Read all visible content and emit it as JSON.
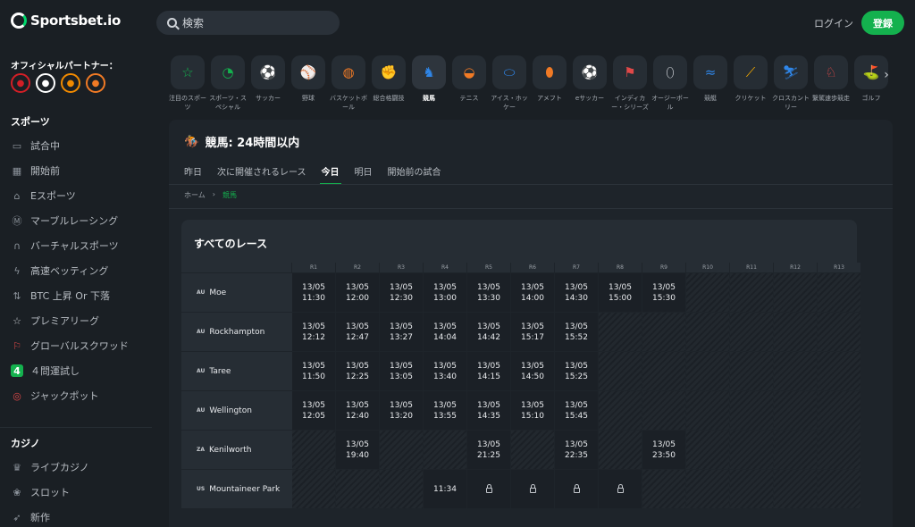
{
  "brand": {
    "name": "Sportsbet.io"
  },
  "search": {
    "placeholder": "検索"
  },
  "header": {
    "login": "ログイン",
    "register": "登録"
  },
  "sidebar": {
    "partner_title": "オフィシャルパートナー：",
    "partners": [
      {
        "icon": "flamengo-logo",
        "color": "#d31f26"
      },
      {
        "icon": "newcastle-logo",
        "color": "#ffffff"
      },
      {
        "icon": "hull-city-logo",
        "color": "#f18a00"
      },
      {
        "icon": "basketball-logo",
        "color": "#f07a25"
      }
    ],
    "sports_title": "スポーツ",
    "sports_items": [
      {
        "label": "試合中",
        "icon": "monitor-icon"
      },
      {
        "label": "開始前",
        "icon": "calendar-icon"
      },
      {
        "label": "Eスポーツ",
        "icon": "gamepad-icon"
      },
      {
        "label": "マーブルレーシング",
        "icon": "marble-icon"
      },
      {
        "label": "バーチャルスポーツ",
        "icon": "headset-icon"
      },
      {
        "label": "高速ベッティング",
        "icon": "bolt-icon"
      },
      {
        "label": "BTC 上昇 Or 下落",
        "icon": "updown-icon"
      },
      {
        "label": "プレミアリーグ",
        "icon": "star-icon"
      },
      {
        "label": "グローバルスクワッド",
        "icon": "squad-icon"
      },
      {
        "label": "４問運試し",
        "icon": "four-icon"
      },
      {
        "label": "ジャックポット",
        "icon": "target-icon"
      }
    ],
    "casino_title": "カジノ",
    "casino_items": [
      {
        "label": "ライブカジノ",
        "icon": "dealer-icon"
      },
      {
        "label": "スロット",
        "icon": "cherry-icon"
      },
      {
        "label": "新作",
        "icon": "rocket-icon"
      }
    ]
  },
  "sports_bar": [
    {
      "label": "注目のスポーツ",
      "icon": "star-icon",
      "color": "#14b14e"
    },
    {
      "label": "スポーツ・スペシャル",
      "icon": "special-icon",
      "color": "#14b14e"
    },
    {
      "label": "サッカー",
      "icon": "soccer-icon",
      "color": "#e04848"
    },
    {
      "label": "野球",
      "icon": "baseball-icon",
      "color": "#e04848"
    },
    {
      "label": "バスケットボール",
      "icon": "basketball-icon",
      "color": "#f07a25"
    },
    {
      "label": "総合格闘技",
      "icon": "mma-icon",
      "color": "#f2a900"
    },
    {
      "label": "競馬",
      "icon": "horse-racing-icon",
      "color": "#2f86e8"
    },
    {
      "label": "テニス",
      "icon": "tennis-icon",
      "color": "#f07a25"
    },
    {
      "label": "アイス・ホッケー",
      "icon": "ice-hockey-icon",
      "color": "#2f86e8"
    },
    {
      "label": "アメフト",
      "icon": "football-icon",
      "color": "#f07a25"
    },
    {
      "label": "eサッカー",
      "icon": "esoccer-icon",
      "color": "#e04848"
    },
    {
      "label": "インディカー・シリーズ",
      "icon": "flag-icon",
      "color": "#e04848"
    },
    {
      "label": "オージーボール",
      "icon": "aussie-ball-icon",
      "color": "#c4c8cd"
    },
    {
      "label": "競艇",
      "icon": "boat-icon",
      "color": "#2f86e8"
    },
    {
      "label": "クリケット",
      "icon": "cricket-icon",
      "color": "#f2a900"
    },
    {
      "label": "クロスカントリー",
      "icon": "ski-icon",
      "color": "#2f86e8"
    },
    {
      "label": "繋駕速歩競走",
      "icon": "harness-icon",
      "color": "#e04848"
    },
    {
      "label": "ゴルフ",
      "icon": "golf-icon",
      "color": "#f2a900"
    }
  ],
  "main": {
    "title": "競馬: 24時間以内",
    "tabs": [
      "昨日",
      "次に開催されるレース",
      "今日",
      "明日",
      "開始前の試合"
    ],
    "active_tab": 2,
    "breadcrumb": [
      "ホーム",
      "競馬"
    ],
    "card_title": "すべてのレース",
    "columns": [
      "R1",
      "R2",
      "R3",
      "R4",
      "R5",
      "R6",
      "R7",
      "R8",
      "R9",
      "R10",
      "R11",
      "R12",
      "R13"
    ],
    "rows": [
      {
        "cc": "AU",
        "name": "Moe",
        "cells": [
          {
            "d": "13/05",
            "t": "11:30"
          },
          {
            "d": "13/05",
            "t": "12:00"
          },
          {
            "d": "13/05",
            "t": "12:30"
          },
          {
            "d": "13/05",
            "t": "13:00"
          },
          {
            "d": "13/05",
            "t": "13:30"
          },
          {
            "d": "13/05",
            "t": "14:00"
          },
          {
            "d": "13/05",
            "t": "14:30"
          },
          {
            "d": "13/05",
            "t": "15:00"
          },
          {
            "d": "13/05",
            "t": "15:30"
          },
          null,
          null,
          null,
          null
        ]
      },
      {
        "cc": "AU",
        "name": "Rockhampton",
        "cells": [
          {
            "d": "13/05",
            "t": "12:12"
          },
          {
            "d": "13/05",
            "t": "12:47"
          },
          {
            "d": "13/05",
            "t": "13:27"
          },
          {
            "d": "13/05",
            "t": "14:04"
          },
          {
            "d": "13/05",
            "t": "14:42"
          },
          {
            "d": "13/05",
            "t": "15:17"
          },
          {
            "d": "13/05",
            "t": "15:52"
          },
          null,
          null,
          null,
          null,
          null,
          null
        ]
      },
      {
        "cc": "AU",
        "name": "Taree",
        "cells": [
          {
            "d": "13/05",
            "t": "11:50"
          },
          {
            "d": "13/05",
            "t": "12:25"
          },
          {
            "d": "13/05",
            "t": "13:05"
          },
          {
            "d": "13/05",
            "t": "13:40"
          },
          {
            "d": "13/05",
            "t": "14:15"
          },
          {
            "d": "13/05",
            "t": "14:50"
          },
          {
            "d": "13/05",
            "t": "15:25"
          },
          null,
          null,
          null,
          null,
          null,
          null
        ]
      },
      {
        "cc": "AU",
        "name": "Wellington",
        "cells": [
          {
            "d": "13/05",
            "t": "12:05"
          },
          {
            "d": "13/05",
            "t": "12:40"
          },
          {
            "d": "13/05",
            "t": "13:20"
          },
          {
            "d": "13/05",
            "t": "13:55"
          },
          {
            "d": "13/05",
            "t": "14:35"
          },
          {
            "d": "13/05",
            "t": "15:10"
          },
          {
            "d": "13/05",
            "t": "15:45"
          },
          null,
          null,
          null,
          null,
          null,
          null
        ]
      },
      {
        "cc": "ZA",
        "name": "Kenilworth",
        "cells": [
          null,
          {
            "d": "13/05",
            "t": "19:40"
          },
          null,
          null,
          {
            "d": "13/05",
            "t": "21:25"
          },
          null,
          {
            "d": "13/05",
            "t": "22:35"
          },
          null,
          {
            "d": "13/05",
            "t": "23:50"
          },
          null,
          null,
          null,
          null
        ]
      },
      {
        "cc": "US",
        "name": "Mountaineer Park",
        "cells": [
          null,
          null,
          null,
          {
            "d": "",
            "t": "11:34"
          },
          {
            "lock": true
          },
          {
            "lock": true
          },
          {
            "lock": true
          },
          {
            "lock": true
          },
          null,
          null,
          null,
          null,
          null
        ]
      }
    ]
  }
}
